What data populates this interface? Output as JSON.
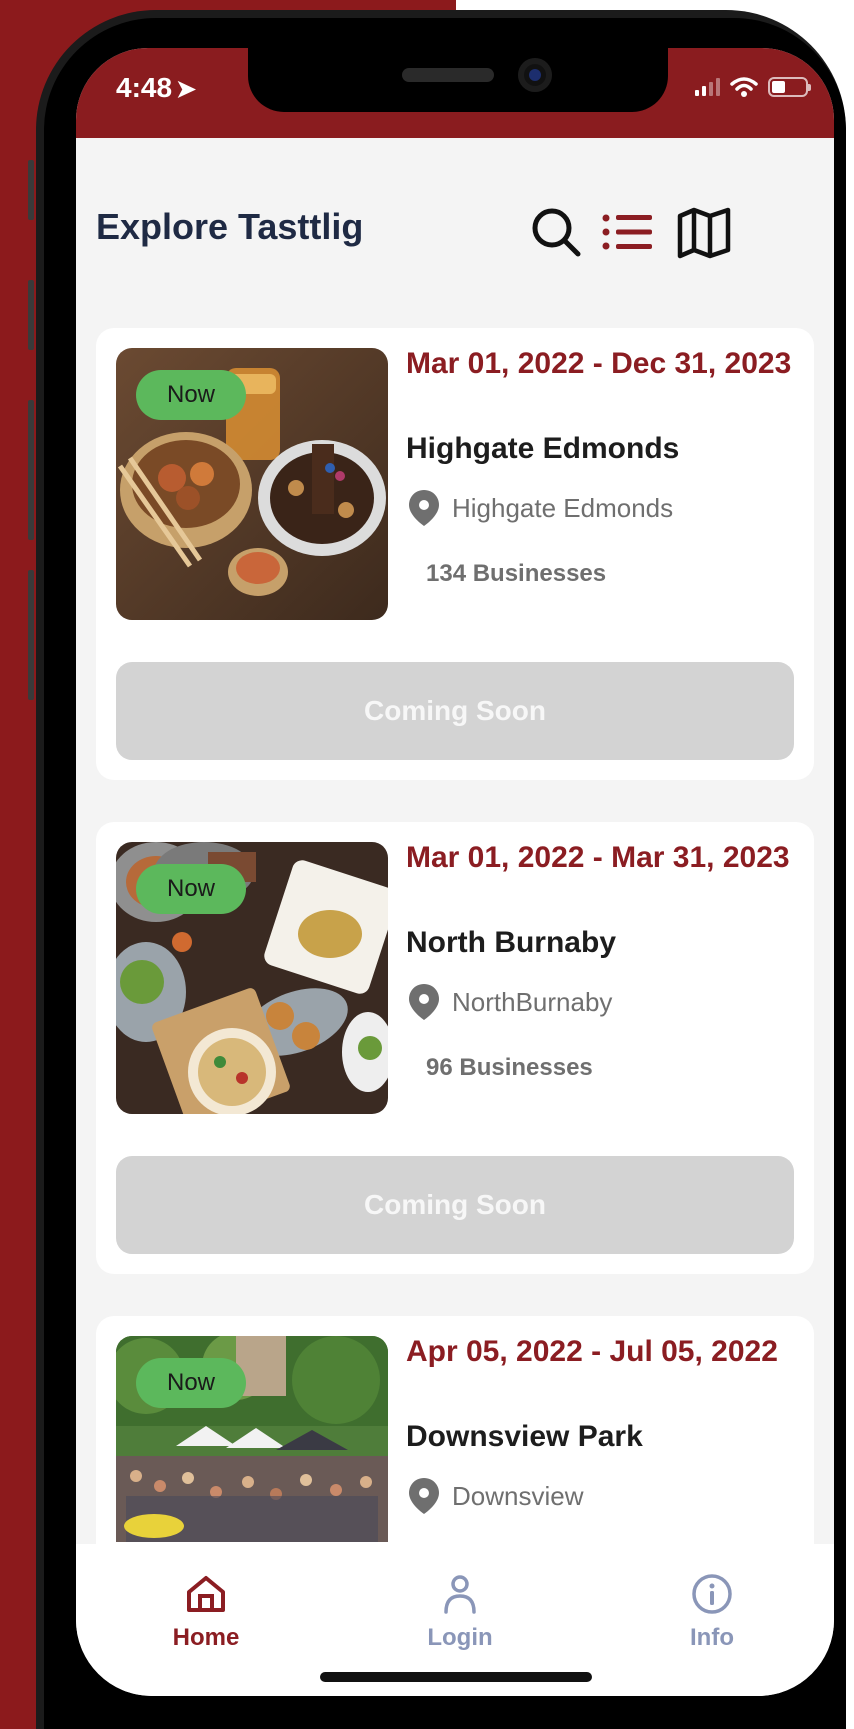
{
  "status_bar": {
    "time": "4:48"
  },
  "header": {
    "title": "Explore Tasttlig"
  },
  "festivals": [
    {
      "badge": "Now",
      "dates": "Mar 01, 2022 - Dec 31, 2023",
      "name": "Highgate Edmonds",
      "location": "Highgate Edmonds",
      "businesses": "134 Businesses",
      "button": "Coming Soon"
    },
    {
      "badge": "Now",
      "dates": "Mar 01, 2022 - Mar 31, 2023",
      "name": "North Burnaby",
      "location": "NorthBurnaby",
      "businesses": "96 Businesses",
      "button": "Coming Soon"
    },
    {
      "badge": "Now",
      "dates": "Apr 05, 2022 - Jul 05, 2022",
      "name": "Downsview Park",
      "location": "Downsview"
    }
  ],
  "tabs": [
    {
      "label": "Home",
      "icon": "home-icon",
      "active": true
    },
    {
      "label": "Login",
      "icon": "user-icon",
      "active": false
    },
    {
      "label": "Info",
      "icon": "info-icon",
      "active": false
    }
  ],
  "colors": {
    "brand": "#8a1c1f",
    "badge": "#5cb85c",
    "title": "#1f2a44",
    "disabled_button": "#d3d3d3",
    "inactive_tab": "#8a96b8"
  }
}
